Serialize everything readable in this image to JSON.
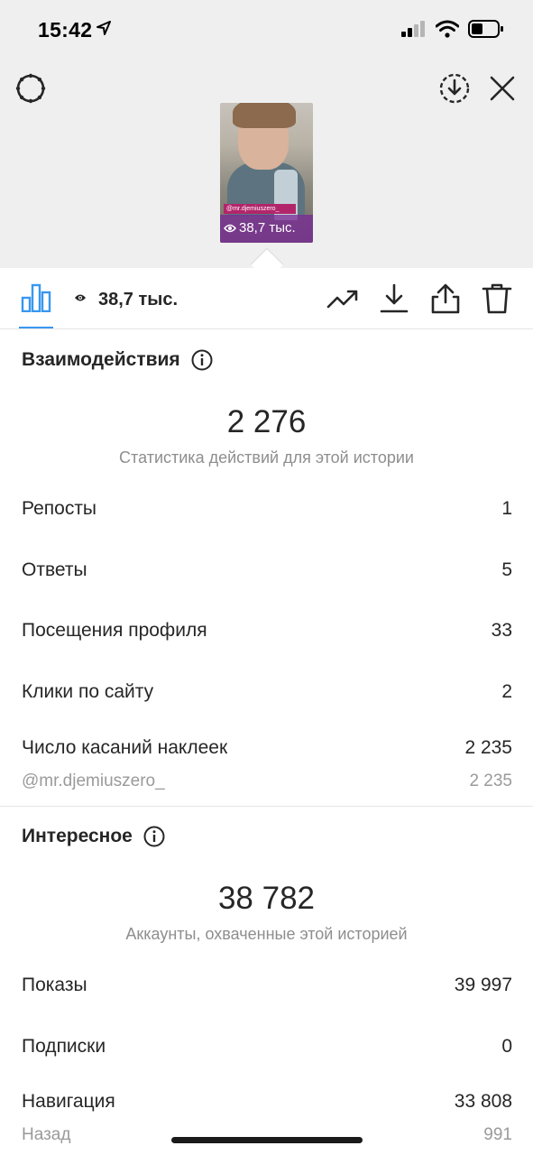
{
  "status_bar": {
    "time": "15:42"
  },
  "story": {
    "thumbnail_tag": "@mr.djemiuszero_",
    "thumbnail_views": "38,7 тыс."
  },
  "toolbar": {
    "views": "38,7 тыс."
  },
  "interactions": {
    "title": "Взаимодействия",
    "total": "2 276",
    "caption": "Статистика действий для этой истории",
    "rows": [
      {
        "label": "Репосты",
        "value": "1"
      },
      {
        "label": "Ответы",
        "value": "5"
      },
      {
        "label": "Посещения профиля",
        "value": "33"
      },
      {
        "label": "Клики по сайту",
        "value": "2"
      },
      {
        "label": "Число касаний наклеек",
        "value": "2 235"
      }
    ],
    "sticker_sub": {
      "label": "@mr.djemiuszero_",
      "value": "2 235"
    }
  },
  "discovery": {
    "title": "Интересное",
    "total": "38 782",
    "caption": "Аккаунты, охваченные этой историей",
    "rows": [
      {
        "label": "Показы",
        "value": "39 997"
      },
      {
        "label": "Подписки",
        "value": "0"
      },
      {
        "label": "Навигация",
        "value": "33 808"
      }
    ],
    "nav_sub": {
      "label": "Назад",
      "value": "991"
    }
  },
  "colors": {
    "accent": "#3897f0",
    "text": "#262626",
    "secondary": "#8e8e8e",
    "top_bg": "#efefef"
  }
}
